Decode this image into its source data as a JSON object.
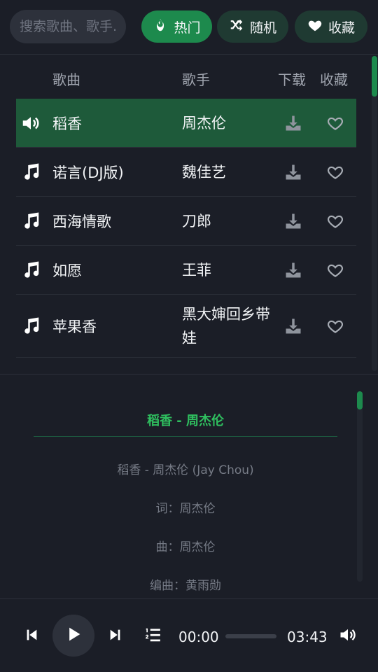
{
  "search": {
    "placeholder": "搜索歌曲、歌手..."
  },
  "filters": [
    {
      "label": "热门",
      "icon": "fire-icon",
      "active": true
    },
    {
      "label": "随机",
      "icon": "shuffle-icon",
      "active": false
    },
    {
      "label": "收藏",
      "icon": "heart-icon",
      "active": false
    }
  ],
  "table": {
    "headers": {
      "song": "歌曲",
      "artist": "歌手",
      "download": "下载",
      "favorite": "收藏"
    },
    "rows": [
      {
        "song": "稻香",
        "artist": "周杰伦",
        "playing": true
      },
      {
        "song": "诺言(DJ版)",
        "artist": "魏佳艺",
        "playing": false
      },
      {
        "song": "西海情歌",
        "artist": "刀郎",
        "playing": false
      },
      {
        "song": "如愿",
        "artist": "王菲",
        "playing": false
      },
      {
        "song": "苹果香",
        "artist": "黑大婶回乡带娃",
        "playing": false
      }
    ]
  },
  "lyrics": {
    "title": "稻香 - 周杰伦",
    "lines": [
      "稻香 - 周杰伦 (Jay Chou)",
      "词：周杰伦",
      "曲：周杰伦",
      "编曲：黄雨勋"
    ]
  },
  "player": {
    "current_time": "00:00",
    "duration": "03:43",
    "progress": 0
  },
  "colors": {
    "accent": "#1d8a4d",
    "lyrics_title": "#2fbf5f",
    "background": "#1b1e27"
  }
}
